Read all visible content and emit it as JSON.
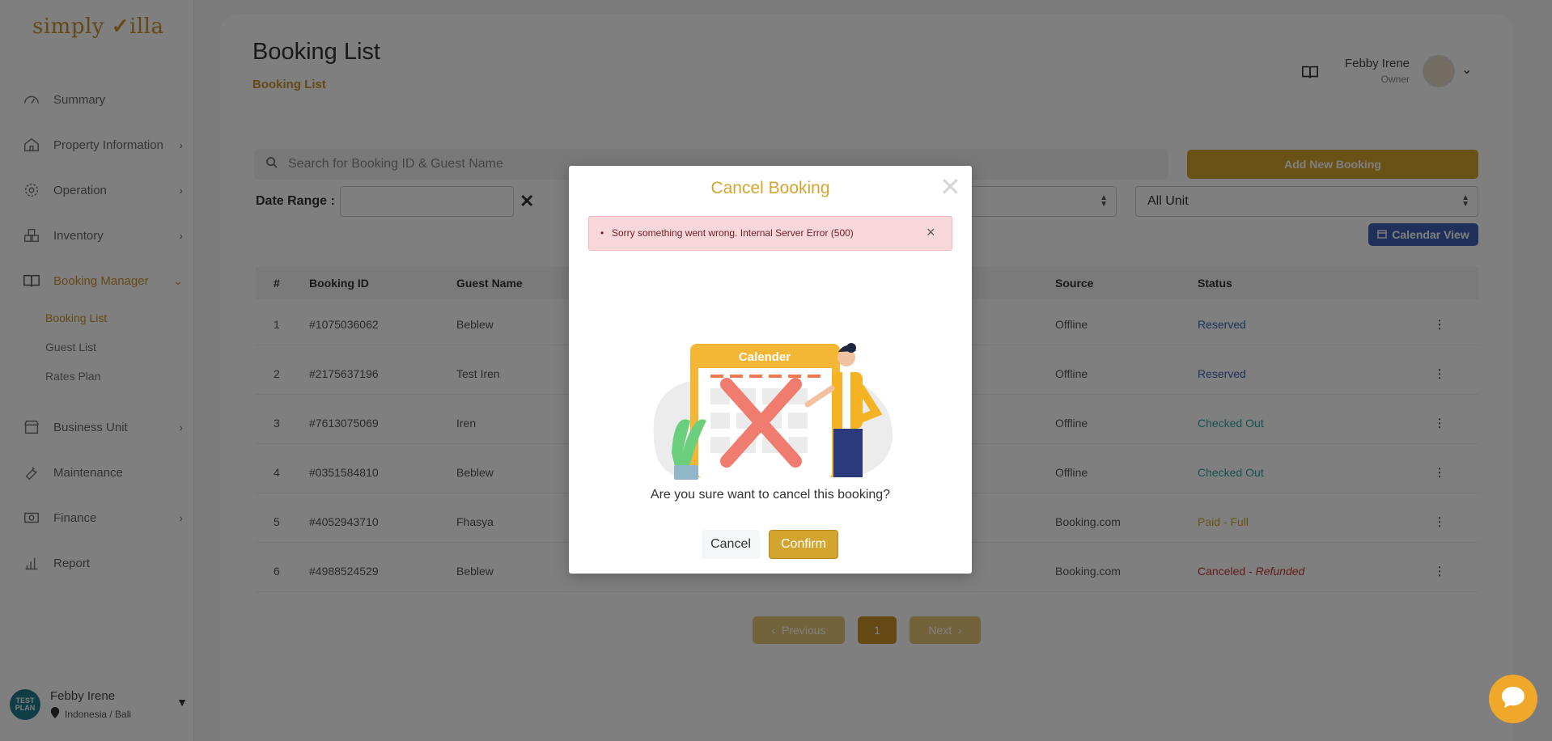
{
  "app": {
    "logo_left": "simply",
    "logo_right": "illa"
  },
  "sidebar": {
    "items": [
      {
        "label": "Summary"
      },
      {
        "label": "Property Information"
      },
      {
        "label": "Operation"
      },
      {
        "label": "Inventory"
      },
      {
        "label": "Booking Manager"
      },
      {
        "label": "Business Unit"
      },
      {
        "label": "Maintenance"
      },
      {
        "label": "Finance"
      },
      {
        "label": "Report"
      }
    ],
    "sub_items": [
      {
        "label": "Booking List"
      },
      {
        "label": "Guest List"
      },
      {
        "label": "Rates Plan"
      }
    ],
    "user": {
      "name": "Febby Irene",
      "location": "Indonesia / Bali",
      "avatar_text": "TEST PLAN"
    }
  },
  "header": {
    "title": "Booking List",
    "breadcrumb": "Booking List",
    "user_name": "Febby Irene",
    "user_role": "Owner"
  },
  "toolbar": {
    "search_placeholder": "Search for Booking ID & Guest Name",
    "add_label": "Add New Booking",
    "date_range_label": "Date Range :",
    "unit_select": "All Unit",
    "calendar_label": "Calendar View"
  },
  "table": {
    "headers": {
      "num": "#",
      "id": "Booking ID",
      "guest": "Guest Name",
      "source": "Source",
      "status": "Status"
    },
    "rows": [
      {
        "num": "1",
        "id": "#1075036062",
        "guest": "Beblew",
        "source": "Offline",
        "status": "Reserved"
      },
      {
        "num": "2",
        "id": "#2175637196",
        "guest": "Test Iren",
        "source": "Offline",
        "status": "Reserved"
      },
      {
        "num": "3",
        "id": "#7613075069",
        "guest": "Iren",
        "source": "Offline",
        "status": "Checked Out"
      },
      {
        "num": "4",
        "id": "#0351584810",
        "guest": "Beblew",
        "source": "Offline",
        "status": "Checked Out"
      },
      {
        "num": "5",
        "id": "#4052943710",
        "guest": "Fhasya",
        "source": "Booking.com",
        "status": "Paid - Full"
      },
      {
        "num": "6",
        "id": "#4988524529",
        "guest": "Beblew",
        "source": "Booking.com",
        "status": "Canceled - ",
        "status_extra": "Refunded"
      }
    ]
  },
  "pagination": {
    "prev": "Previous",
    "page": "1",
    "next": "Next"
  },
  "modal": {
    "title": "Cancel Booking",
    "error": "Sorry something went wrong. Internal Server Error (500)",
    "illustration_label": "Calender",
    "question": "Are you sure want to cancel this booking?",
    "cancel_label": "Cancel",
    "confirm_label": "Confirm"
  },
  "colors": {
    "brand": "#d4a52e",
    "blue": "#3f63b5",
    "teal": "#2aa1a1",
    "danger": "#c0392b"
  }
}
